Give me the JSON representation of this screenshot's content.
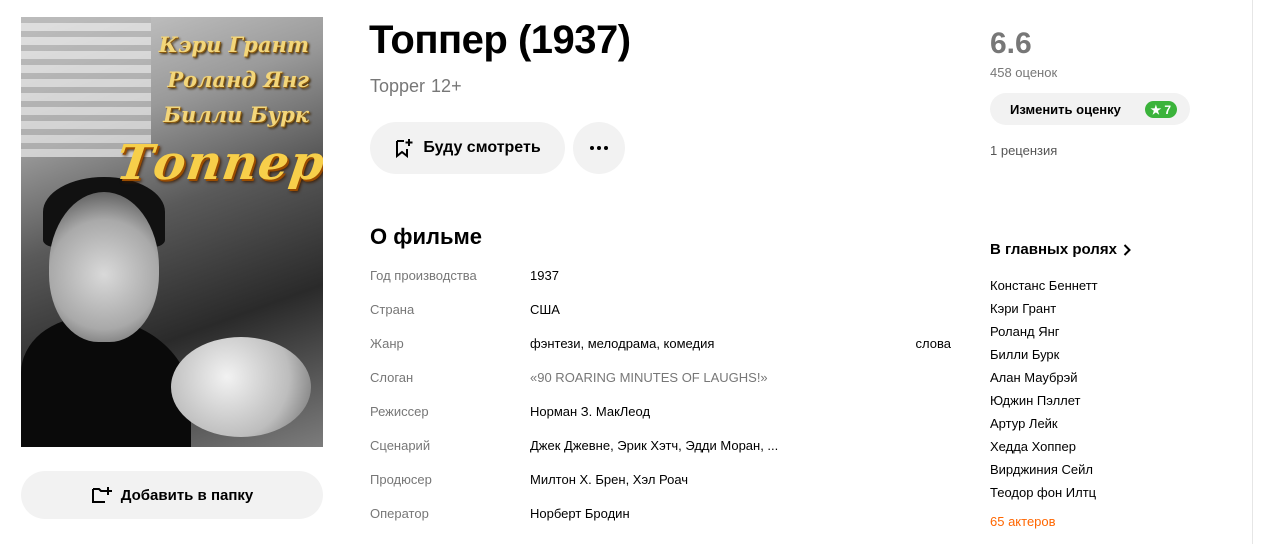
{
  "poster": {
    "actor_names": [
      "Кэри Грант",
      "Роланд Янг",
      "Билли Бурк"
    ],
    "title_text": "Топпер"
  },
  "folder_button": {
    "label": "Добавить в папку"
  },
  "film": {
    "title": "Топпер (1937)",
    "original_title": "Topper",
    "age_rating": "12+"
  },
  "actions": {
    "watch_label": "Буду смотреть"
  },
  "about": {
    "heading": "О фильме",
    "rows": [
      {
        "label": "Год производства",
        "value": "1937"
      },
      {
        "label": "Страна",
        "value": "США"
      },
      {
        "label": "Жанр",
        "value": "фэнтези, мелодрама, комедия",
        "extra": "слова"
      },
      {
        "label": "Слоган",
        "value": "«90 ROARING MINUTES OF LAUGHS!»"
      },
      {
        "label": "Режиссер",
        "value": "Норман З. МакЛеод"
      },
      {
        "label": "Сценарий",
        "value": "Джек Джевне, Эрик Хэтч, Эдди Моран, ..."
      },
      {
        "label": "Продюсер",
        "value": "Милтон Х. Брен, Хэл Роач"
      },
      {
        "label": "Оператор",
        "value": "Норберт Бродин"
      }
    ]
  },
  "rating": {
    "score": "6.6",
    "votes": "458 оценок",
    "change_label": "Изменить оценку",
    "my_score": "7",
    "reviews": "1 рецензия"
  },
  "cast": {
    "heading": "В главных ролях",
    "actors": [
      "Констанс Беннетт",
      "Кэри Грант",
      "Роланд Янг",
      "Билли Бурк",
      "Алан Маубрэй",
      "Юджин Пэллет",
      "Артур Лейк",
      "Хедда Хоппер",
      "Вирджиния Сейл",
      "Теодор фон Илтц"
    ],
    "more_label": "65 актеров"
  },
  "colors": {
    "accent_orange": "#ff6600",
    "rating_green": "#3bb33b",
    "button_bg": "#f2f2f2"
  }
}
